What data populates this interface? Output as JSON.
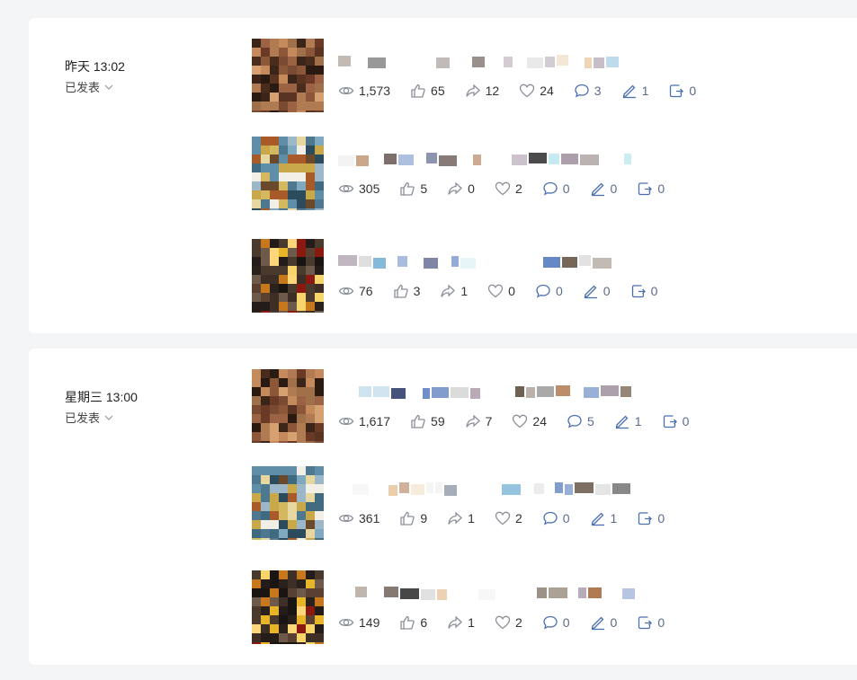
{
  "groups": [
    {
      "time": "昨天 13:02",
      "status": "已发表",
      "posts": [
        {
          "views": "1,573",
          "likes": "65",
          "shares": "12",
          "favs": "24",
          "comments": "3",
          "edits": "1",
          "reposts": "0",
          "thumb": "portrait-a"
        },
        {
          "views": "305",
          "likes": "5",
          "shares": "0",
          "favs": "2",
          "comments": "0",
          "edits": "0",
          "reposts": "0",
          "thumb": "blue-b"
        },
        {
          "views": "76",
          "likes": "3",
          "shares": "1",
          "favs": "0",
          "comments": "0",
          "edits": "0",
          "reposts": "0",
          "thumb": "dark-c"
        }
      ]
    },
    {
      "time": "星期三 13:00",
      "status": "已发表",
      "posts": [
        {
          "views": "1,617",
          "likes": "59",
          "shares": "7",
          "favs": "24",
          "comments": "5",
          "edits": "1",
          "reposts": "0",
          "thumb": "portrait-a"
        },
        {
          "views": "361",
          "likes": "9",
          "shares": "1",
          "favs": "2",
          "comments": "0",
          "edits": "1",
          "reposts": "0",
          "thumb": "blue-b"
        },
        {
          "views": "149",
          "likes": "6",
          "shares": "1",
          "favs": "2",
          "comments": "0",
          "edits": "0",
          "reposts": "0",
          "thumb": "dark-c"
        }
      ]
    }
  ],
  "icons": {
    "views": "eye-icon",
    "likes": "thumbs-up-icon",
    "shares": "share-arrow-icon",
    "favs": "heart-icon",
    "comments": "comment-bubble-icon",
    "edits": "pen-icon",
    "reposts": "repost-icon",
    "status_toggle": "chevron-down-icon"
  },
  "colors": {
    "page_bg": "#f4f5f7",
    "card_bg": "#ffffff",
    "stat_text": "#333333",
    "icon": "#8a8f99",
    "icon_accent": "#4a6fb0"
  }
}
